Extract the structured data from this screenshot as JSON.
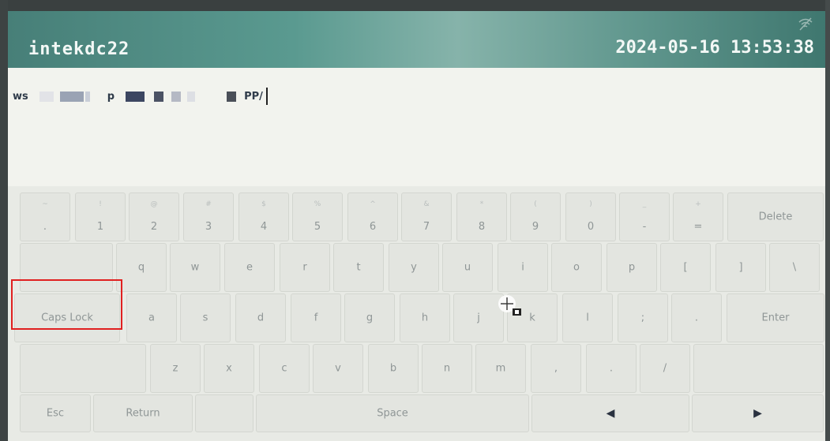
{
  "header": {
    "device_name": "intekdc22",
    "datetime": "2024-05-16 13:53:38",
    "status_icon": "wifi-off-icon"
  },
  "text_area": {
    "segments": [
      "ws",
      "p",
      "PP/"
    ]
  },
  "keyboard": {
    "row1": [
      {
        "main": ".",
        "shift": "~"
      },
      {
        "main": "1",
        "shift": "!"
      },
      {
        "main": "2",
        "shift": "@"
      },
      {
        "main": "3",
        "shift": "#"
      },
      {
        "main": "4",
        "shift": "$"
      },
      {
        "main": "5",
        "shift": "%"
      },
      {
        "main": "6",
        "shift": "^"
      },
      {
        "main": "7",
        "shift": "&"
      },
      {
        "main": "8",
        "shift": "*"
      },
      {
        "main": "9",
        "shift": "("
      },
      {
        "main": "0",
        "shift": ")"
      },
      {
        "main": "-",
        "shift": "_"
      },
      {
        "main": "=",
        "shift": "+"
      }
    ],
    "delete_label": "Delete",
    "row2": [
      "q",
      "w",
      "e",
      "r",
      "t",
      "y",
      "u",
      "i",
      "o",
      "p",
      "[",
      "]",
      "\\"
    ],
    "caps_lock_label": "Caps Lock",
    "row3": [
      "a",
      "s",
      "d",
      "f",
      "g",
      "h",
      "j",
      "k",
      "l",
      ";",
      "."
    ],
    "enter_label": "Enter",
    "row4": [
      "z",
      "x",
      "c",
      "v",
      "b",
      "n",
      "m",
      ",",
      ".",
      "/"
    ],
    "esc_label": "Esc",
    "return_label": "Return",
    "space_label": "Space",
    "left_arrow": "◀",
    "right_arrow": "▶"
  },
  "colors": {
    "header": "#4f8a82",
    "highlight": "#e02020"
  }
}
